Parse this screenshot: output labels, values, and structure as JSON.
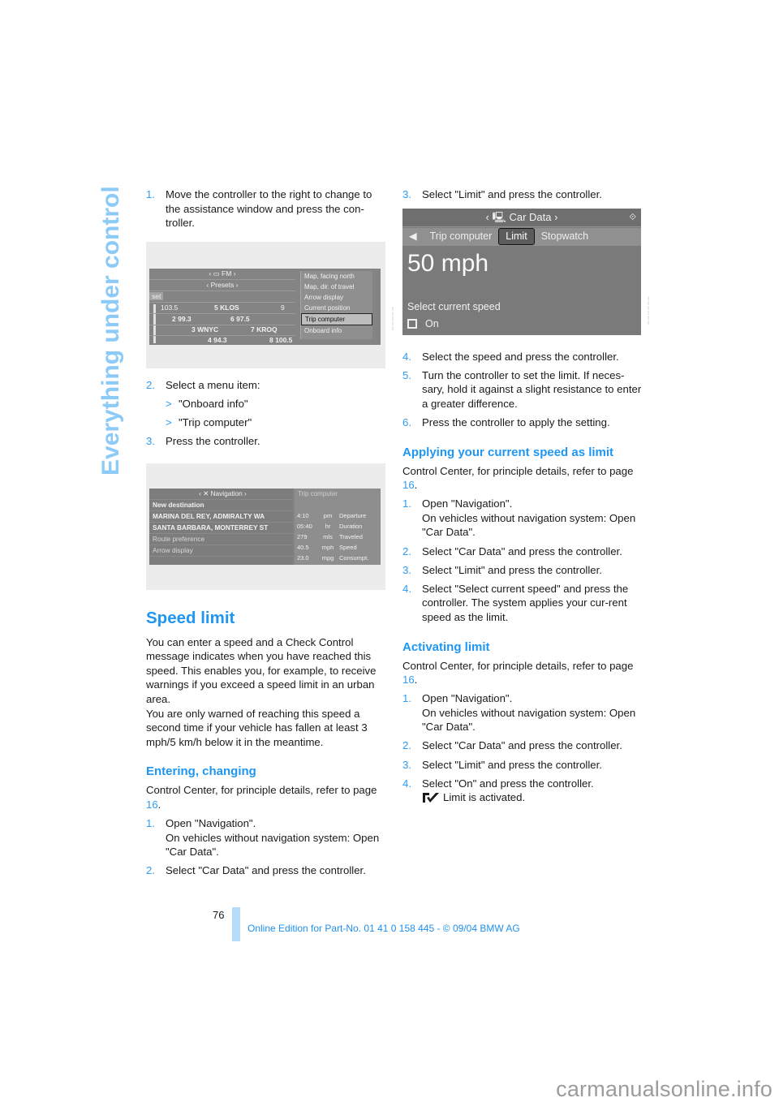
{
  "side_title": "Everything under control",
  "left": {
    "intro_steps": [
      {
        "num": "1.",
        "text": "Move the controller to the right to change to the assistance window and press the con-troller."
      }
    ],
    "figure1": {
      "radio_top": "FM",
      "presets": "Presets",
      "set": "set",
      "stations": [
        [
          "1",
          "103.5",
          "5",
          "KLOS",
          "9"
        ],
        [
          "2",
          "99.3",
          "6",
          "97.5",
          ""
        ],
        [
          "3",
          "WNYC",
          "7",
          "KROQ",
          ""
        ],
        [
          "4",
          "94.3",
          "8",
          "100.5",
          ""
        ]
      ],
      "menu": [
        "Map, facing north",
        "Map, dir. of travel",
        "Arrow display",
        "Current position",
        "Trip computer",
        "Onboard info"
      ],
      "menu_selected": "Trip computer"
    },
    "step2": {
      "num": "2.",
      "text": "Select a menu item:"
    },
    "bullets": [
      "\"Onboard info\"",
      "\"Trip computer\""
    ],
    "step3": {
      "num": "3.",
      "text": "Press the controller."
    },
    "figure2": {
      "header": "Navigation",
      "nav_rows": [
        "New destination",
        "MARINA DEL REY, ADMIRALTY WA",
        "SANTA BARBARA, MONTERREY ST",
        "Route preference",
        "Arrow display"
      ],
      "trip_title": "Trip computer",
      "trip_rows": [
        [
          "4:10",
          "pm",
          "Departure"
        ],
        [
          "05:40",
          "hr",
          "Duration"
        ],
        [
          "279",
          "mls",
          "Traveled"
        ],
        [
          "40.5",
          "mph",
          "Speed"
        ],
        [
          "23.0",
          "mpg",
          "Consumpt."
        ]
      ]
    },
    "speed_limit": {
      "heading": "Speed limit",
      "para1": "You can enter a speed and a Check Control message indicates when you have reached this speed. This enables you, for example, to receive warnings if you exceed a speed limit in an urban area.",
      "para2": "You are only warned of reaching this speed a second time if your vehicle has fallen at least 3 mph/5 km/h below it in the meantime."
    },
    "entering": {
      "heading": "Entering, changing",
      "intro": "Control Center, for principle details, refer to page ",
      "page_link": "16",
      "steps": [
        {
          "num": "1.",
          "line1": "Open \"Navigation\".",
          "line2": "On vehicles without navigation system: Open \"Car Data\"."
        },
        {
          "num": "2.",
          "line1": "Select \"Car Data\" and press the controller."
        }
      ]
    }
  },
  "right": {
    "step3": {
      "num": "3.",
      "text": "Select \"Limit\" and press the controller."
    },
    "figure3": {
      "header": "Car Data",
      "tabs": [
        "Trip computer",
        "Limit",
        "Stopwatch"
      ],
      "active_tab": "Limit",
      "speed": "50 mph",
      "select_current": "Select current speed",
      "checkbox_label": "On"
    },
    "steps_after": [
      {
        "num": "4.",
        "text": "Select the speed and press the controller."
      },
      {
        "num": "5.",
        "text": "Turn the controller to set the limit. If neces-sary, hold it against a slight resistance to enter a greater difference."
      },
      {
        "num": "6.",
        "text": "Press the controller to apply the setting."
      }
    ],
    "applying": {
      "heading": "Applying your current speed as limit",
      "intro": "Control Center, for principle details, refer to page ",
      "page_link": "16",
      "steps": [
        {
          "num": "1.",
          "line1": "Open \"Navigation\".",
          "line2": "On vehicles without navigation system: Open \"Car Data\"."
        },
        {
          "num": "2.",
          "line1": "Select \"Car Data\" and press the controller."
        },
        {
          "num": "3.",
          "line1": "Select \"Limit\" and press the controller."
        },
        {
          "num": "4.",
          "line1": "Select \"Select current speed\" and press the controller. The system applies your cur-rent speed as the limit."
        }
      ]
    },
    "activating": {
      "heading": "Activating limit",
      "intro": "Control Center, for principle details, refer to page ",
      "page_link": "16",
      "steps": [
        {
          "num": "1.",
          "line1": "Open \"Navigation\".",
          "line2": "On vehicles without navigation system: Open \"Car Data\"."
        },
        {
          "num": "2.",
          "line1": "Select \"Car Data\" and press the controller."
        },
        {
          "num": "3.",
          "line1": "Select \"Limit\" and press the controller."
        },
        {
          "num": "4.",
          "line1": "Select \"On\" and press the controller."
        }
      ],
      "result": "Limit is activated."
    }
  },
  "footer": {
    "page_number": "76",
    "edition": "Online Edition for Part-No. 01 41 0 158 445 - © 09/04 BMW AG"
  },
  "watermark": "carmanualsonline.info",
  "colors": {
    "accent": "#1e96f2",
    "side_title": "#8ccaf8",
    "footer_bar": "#b6dcfa"
  }
}
